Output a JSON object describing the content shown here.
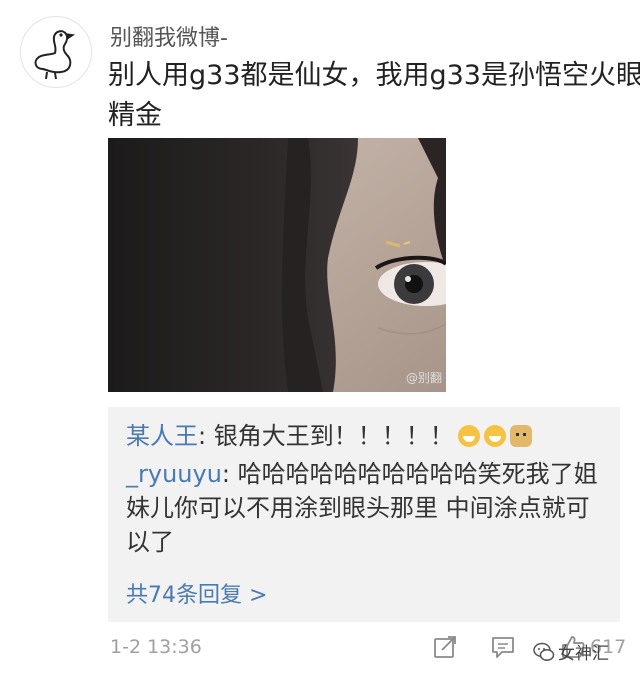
{
  "post": {
    "username": "别翻我微博-",
    "text_line1": "别人用g33都是仙女，我用g33是孙悟空火眼",
    "text_line2": "精金",
    "image_watermark": "@别翻"
  },
  "comments": [
    {
      "author": "某人王",
      "separator": ": ",
      "text": "银角大王到！！！！！",
      "emojis": [
        "grin-emoji",
        "grin-emoji",
        "doge-emoji"
      ]
    },
    {
      "author": "_ryuuyu",
      "separator": ": ",
      "text": "哈哈哈哈哈哈哈哈哈哈笑死我了姐妹儿你可以不用涂到眼头那里 中间涂点就可以了"
    }
  ],
  "replies_link": "共74条回复 >",
  "footer": {
    "timestamp": "1-2 13:36",
    "like_count": "617",
    "brand_text": "女神汇",
    "icons": [
      "share-icon",
      "comment-icon",
      "like-icon"
    ]
  },
  "colors": {
    "link_blue": "#4a7ab2",
    "comment_bg": "#f2f2f2",
    "meta_gray": "#a0a0a0"
  }
}
